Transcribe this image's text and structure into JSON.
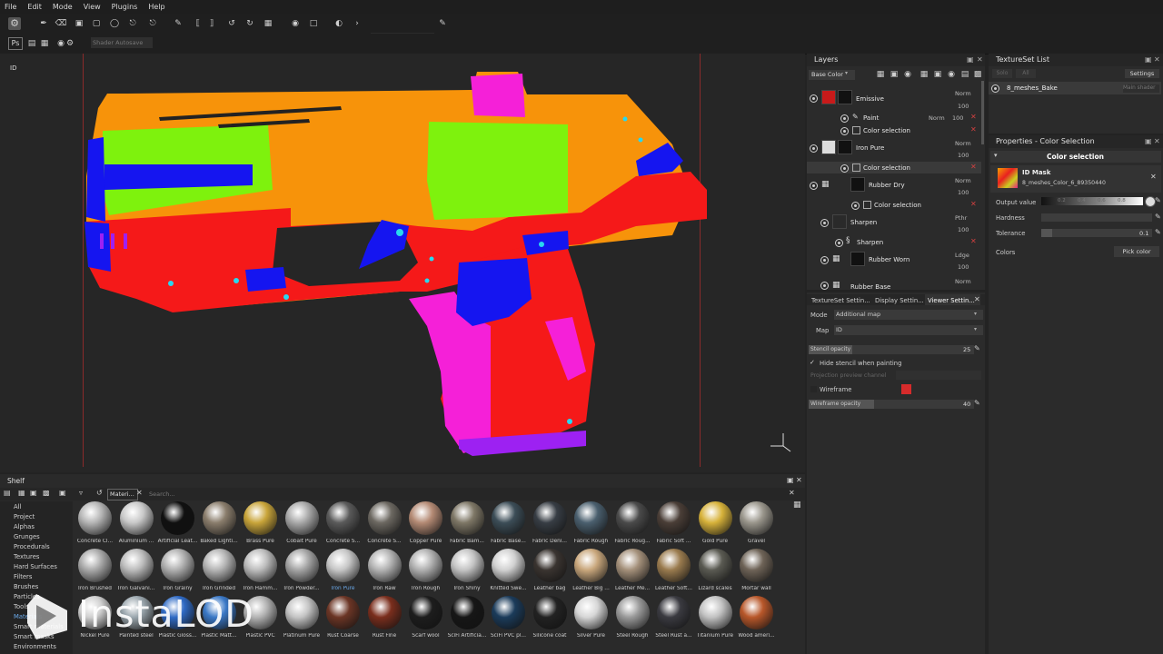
{
  "menu": [
    "File",
    "Edit",
    "Mode",
    "View",
    "Plugins",
    "Help"
  ],
  "toolbar2": {
    "ps_label": "Ps",
    "autosave_label": "Shader Autosave"
  },
  "viewport": {
    "mode_label": "ID"
  },
  "layers_panel": {
    "title": "Layers",
    "channel_select": "Base Color",
    "layers": [
      {
        "name": "Emissive",
        "blend": "Norm",
        "opacity": "100"
      },
      {
        "name": "Paint",
        "blend": "Norm",
        "opacity": "100"
      },
      {
        "name": "Color selection"
      },
      {
        "name": "Iron Pure",
        "blend": "Norm",
        "opacity": "100"
      },
      {
        "name": "Color selection"
      },
      {
        "name": "Rubber Dry",
        "blend": "Norm",
        "opacity": "100"
      },
      {
        "name": "Color selection"
      },
      {
        "name": "Sharpen",
        "blend": "Pthr",
        "opacity": "100"
      },
      {
        "name": "Sharpen"
      },
      {
        "name": "Rubber Worn",
        "blend": "Ldge",
        "opacity": "100"
      },
      {
        "name": "Rubber Base",
        "blend": "Norm"
      }
    ]
  },
  "bottom_tabs": [
    "TextureSet Settin...",
    "Display Settin...",
    "Viewer Settin..."
  ],
  "viewer_settings": {
    "mode_label": "Mode",
    "mode_value": "Additional map",
    "map_label": "Map",
    "map_value": "ID",
    "stencil_label": "Stencil opacity",
    "stencil_value": "25",
    "hide_stencil_label": "Hide stencil when painting",
    "projection_label": "Projection preview channel",
    "wireframe_label": "Wireframe",
    "wireframe_opacity_label": "Wireframe opacity",
    "wireframe_opacity_value": "40",
    "wireframe_color": "#d62b2b"
  },
  "textureset": {
    "title": "TextureSet List",
    "btn_solo": "Solo",
    "btn_all": "All",
    "btn_settings": "Settings",
    "item": "8_meshes_Bake",
    "item_shader": "Main shader"
  },
  "properties": {
    "title": "Properties - Color Selection",
    "section": "Color selection",
    "mask_title": "ID Mask",
    "mask_file": "8_meshes_Color_6_89350440",
    "output_label": "Output value",
    "output_ticks": [
      "0.2",
      "0.4",
      "0.6",
      "0.8"
    ],
    "hardness_label": "Hardness",
    "tolerance_label": "Tolerance",
    "tolerance_value": "0.1",
    "colors_label": "Colors",
    "pick_color_label": "Pick color"
  },
  "shelf": {
    "title": "Shelf",
    "filter_tag": "Materi...",
    "search_placeholder": "Search...",
    "categories": [
      "All",
      "Project",
      "Alphas",
      "Grunges",
      "Procedurals",
      "Textures",
      "Hard Surfaces",
      "Filters",
      "Brushes",
      "Particles",
      "Tools",
      "Materials",
      "Smart materials",
      "Smart masks",
      "Environments"
    ],
    "materials": [
      [
        "Concrete Cl...",
        "Aluminium ...",
        "Artificial Leat...",
        "Baked Lighti...",
        "Brass Pure",
        "Cobalt Pure",
        "Concrete S...",
        "Concrete S...",
        "Copper Pure",
        "Fabric Bam...",
        "Fabric Base...",
        "Fabric Deni...",
        "Fabric Rough",
        "Fabric Roug...",
        "Fabric Soft ...",
        "Gold Pure",
        "Gravel"
      ],
      [
        "Iron Brushed",
        "Iron Galvani...",
        "Iron Grainy",
        "Iron Grinded",
        "Iron Hamm...",
        "Iron Powder...",
        "Iron Pure",
        "Iron Raw",
        "Iron Rough",
        "Iron Shiny",
        "Knitted Swe...",
        "Leather bag",
        "Leather Big ...",
        "Leather Me...",
        "Leather Soft...",
        "Lizard scales",
        "Mortar wall"
      ],
      [
        "Nickel Pure",
        "Painted steel",
        "Plastic Gloss...",
        "Plastic Matt...",
        "Plastic PVC",
        "Platinum Pure",
        "Rust Coarse",
        "Rust Fine",
        "Scarf wool",
        "SciFi Artificia...",
        "SciFi PVC pl...",
        "Silicone coat",
        "Silver Pure",
        "Steel Rough",
        "Steel Rust a...",
        "Titanium Pure",
        "Wood ameri..."
      ]
    ]
  },
  "watermark": "InstaLOD",
  "gun_colors": {
    "orange": "#f7930a",
    "red": "#f51919",
    "green": "#7ef20d",
    "blue": "#1515f0",
    "magenta": "#f520d8",
    "purple": "#9d21f2"
  }
}
